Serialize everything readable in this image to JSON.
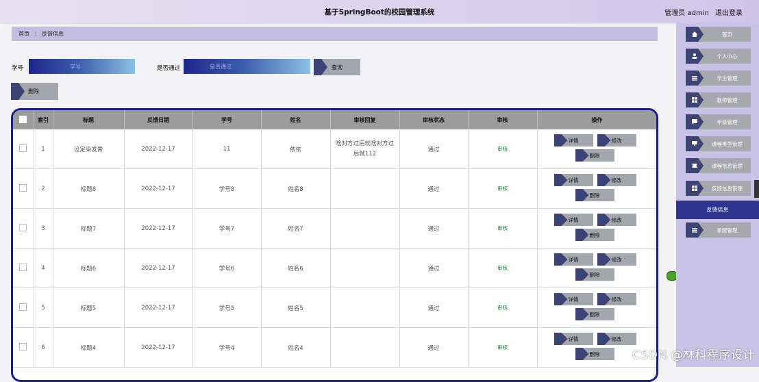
{
  "header": {
    "title": "基于SpringBoot的校园管理系统",
    "user": "管理员 admin",
    "logout": "退出登录"
  },
  "breadcrumb": {
    "home": "首页",
    "sep": "⋮",
    "current": "反馈信息"
  },
  "search": {
    "student_label": "学号",
    "student_placeholder": "学号",
    "pass_label": "是否通过",
    "pass_placeholder": "是否通过",
    "query_button": "查询",
    "delete_button": "删除"
  },
  "table": {
    "headers": [
      "索引",
      "标题",
      "反馈日期",
      "学号",
      "姓名",
      "审核回复",
      "审核状态",
      "审核",
      "操作"
    ],
    "rows": [
      {
        "index": "1",
        "title": "设定染发膏",
        "date": "2022-12-17",
        "student_no": "11",
        "name": "依依",
        "reply": "啥对方过后就啥对方过后就112",
        "status": "通过",
        "audit": "审核"
      },
      {
        "index": "2",
        "title": "标题8",
        "date": "2022-12-17",
        "student_no": "学号8",
        "name": "姓名8",
        "reply": "",
        "status": "通过",
        "audit": "审核"
      },
      {
        "index": "3",
        "title": "标题7",
        "date": "2022-12-17",
        "student_no": "学号7",
        "name": "姓名7",
        "reply": "",
        "status": "通过",
        "audit": "审核"
      },
      {
        "index": "4",
        "title": "标题6",
        "date": "2022-12-17",
        "student_no": "学号6",
        "name": "姓名6",
        "reply": "",
        "status": "通过",
        "audit": "审核"
      },
      {
        "index": "5",
        "title": "标题5",
        "date": "2022-12-17",
        "student_no": "学号5",
        "name": "姓名5",
        "reply": "",
        "status": "通过",
        "audit": "审核"
      },
      {
        "index": "6",
        "title": "标题4",
        "date": "2022-12-17",
        "student_no": "学号4",
        "name": "姓名4",
        "reply": "",
        "status": "通过",
        "audit": "审核"
      }
    ],
    "op_detail": "详情",
    "op_edit": "修改",
    "op_delete": "删除"
  },
  "sidebar": {
    "items": [
      {
        "label": "首页",
        "icon": "home-icon"
      },
      {
        "label": "个人中心",
        "icon": "user-icon"
      },
      {
        "label": "学生管理",
        "icon": "list-icon"
      },
      {
        "label": "教师管理",
        "icon": "grid-icon"
      },
      {
        "label": "年级管理",
        "icon": "chat-icon"
      },
      {
        "label": "课程类型管理",
        "icon": "pin-icon"
      },
      {
        "label": "课程信息管理",
        "icon": "ticket-icon"
      },
      {
        "label": "反馈信息管理",
        "icon": "grid-icon"
      }
    ],
    "active_label": "反馈信息",
    "last_item": {
      "label": "系统管理",
      "icon": "list-icon"
    }
  },
  "watermark": "CSDN @林科程序设计"
}
